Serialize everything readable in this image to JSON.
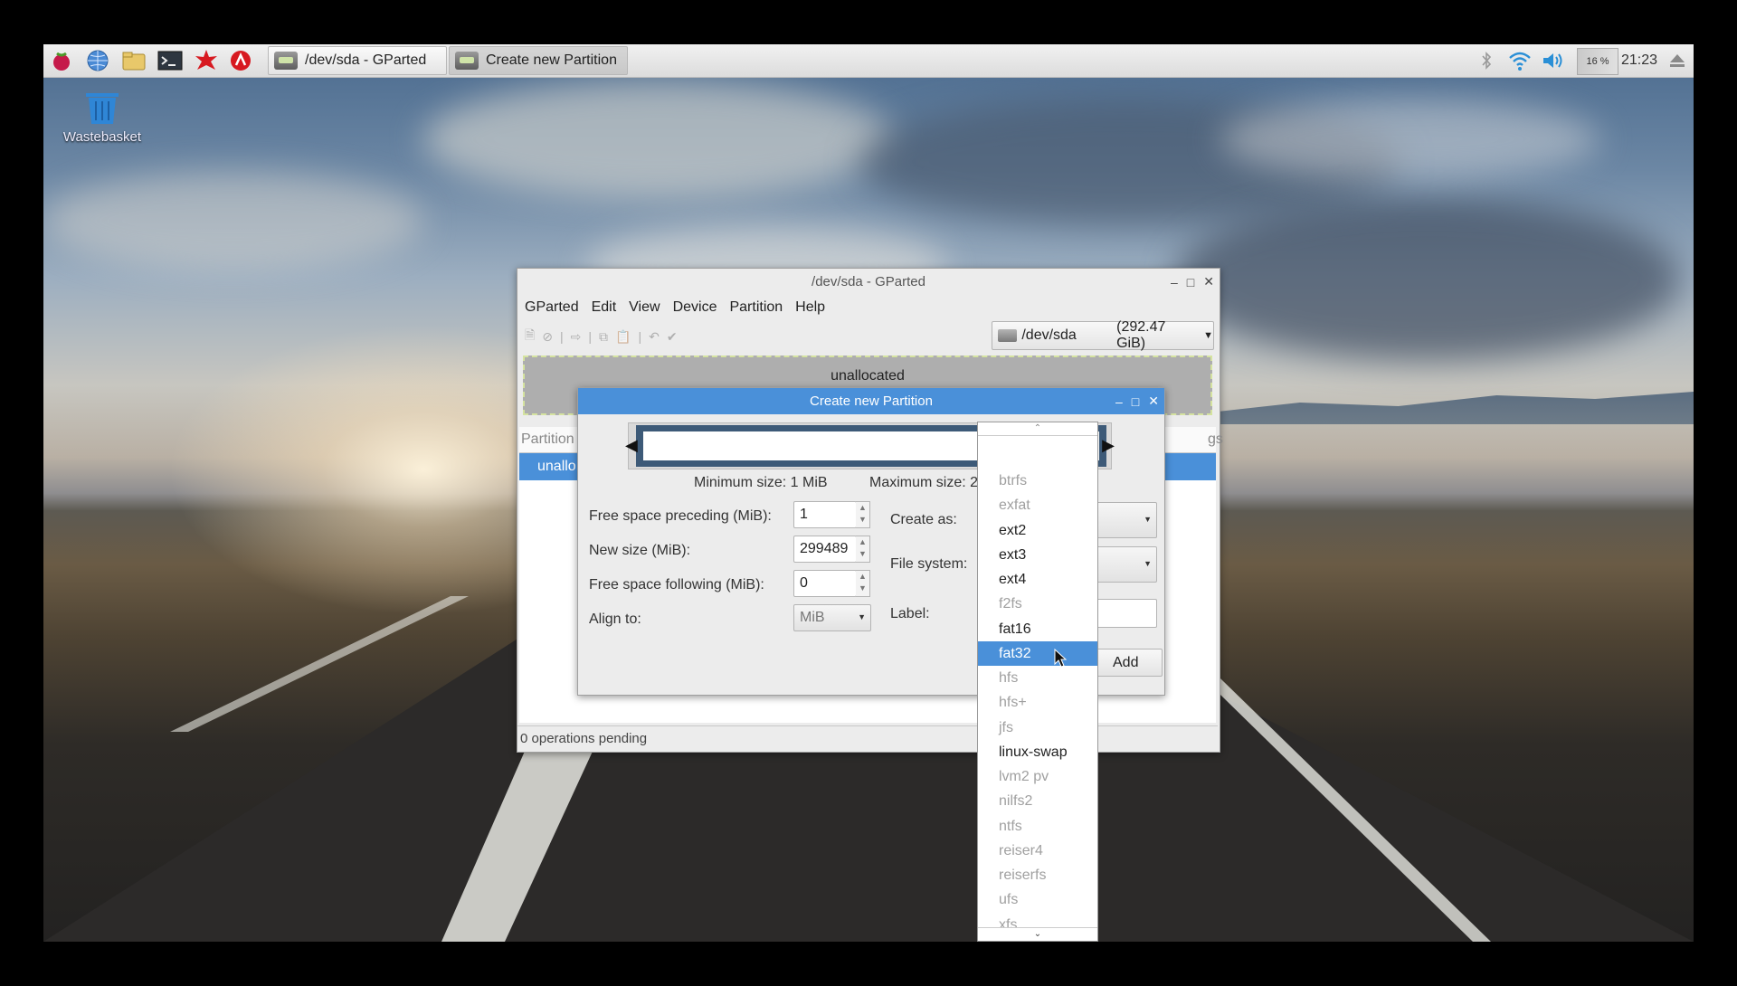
{
  "taskbar": {
    "launchers": [
      {
        "icon": "raspberry-menu-icon"
      },
      {
        "icon": "web-browser-icon"
      },
      {
        "icon": "file-manager-icon"
      },
      {
        "icon": "terminal-icon"
      },
      {
        "icon": "mathematica-icon"
      },
      {
        "icon": "wolfram-icon"
      }
    ],
    "tasks": [
      {
        "label": "/dev/sda - GParted",
        "active": false
      },
      {
        "label": "Create new Partition",
        "active": true
      }
    ],
    "tray": {
      "cpu_label": "16 %",
      "clock": "21:23"
    }
  },
  "desktop": {
    "trash_label": "Wastebasket"
  },
  "gparted": {
    "title": "/dev/sda - GParted",
    "menu": [
      "GParted",
      "Edit",
      "View",
      "Device",
      "Partition",
      "Help"
    ],
    "device_selector": {
      "device": "/dev/sda",
      "size": "(292.47 GiB)"
    },
    "unallocated_label": "unallocated",
    "table_header_left": "Partition",
    "table_header_right": "gs",
    "row_label": "unallo",
    "status": "0 operations pending"
  },
  "dialog": {
    "title": "Create new Partition",
    "min_size": "Minimum size: 1 MiB",
    "max_size": "Maximum size: 2",
    "fields": {
      "preceding_label": "Free space preceding (MiB):",
      "preceding_value": "1",
      "newsize_label": "New size (MiB):",
      "newsize_value": "299489",
      "following_label": "Free space following (MiB):",
      "following_value": "0",
      "align_label": "Align to:",
      "align_value": "MiB",
      "create_as_label": "Create as:",
      "filesystem_label": "File system:",
      "label_label": "Label:"
    },
    "add_button": "Add"
  },
  "fs_dropdown": {
    "items": [
      {
        "label": "btrfs",
        "enabled": false
      },
      {
        "label": "exfat",
        "enabled": false
      },
      {
        "label": "ext2",
        "enabled": true
      },
      {
        "label": "ext3",
        "enabled": true
      },
      {
        "label": "ext4",
        "enabled": true
      },
      {
        "label": "f2fs",
        "enabled": false
      },
      {
        "label": "fat16",
        "enabled": true
      },
      {
        "label": "fat32",
        "enabled": true,
        "selected": true
      },
      {
        "label": "hfs",
        "enabled": false
      },
      {
        "label": "hfs+",
        "enabled": false
      },
      {
        "label": "jfs",
        "enabled": false
      },
      {
        "label": "linux-swap",
        "enabled": true
      },
      {
        "label": "lvm2 pv",
        "enabled": false
      },
      {
        "label": "nilfs2",
        "enabled": false
      },
      {
        "label": "ntfs",
        "enabled": false
      },
      {
        "label": "reiser4",
        "enabled": false
      },
      {
        "label": "reiserfs",
        "enabled": false
      },
      {
        "label": "ufs",
        "enabled": false
      },
      {
        "label": "xfs",
        "enabled": false
      }
    ]
  },
  "colors": {
    "accent": "#4a90d9",
    "disabled_text": "#a0a0a0",
    "partition_bar": "#3d5a78"
  }
}
